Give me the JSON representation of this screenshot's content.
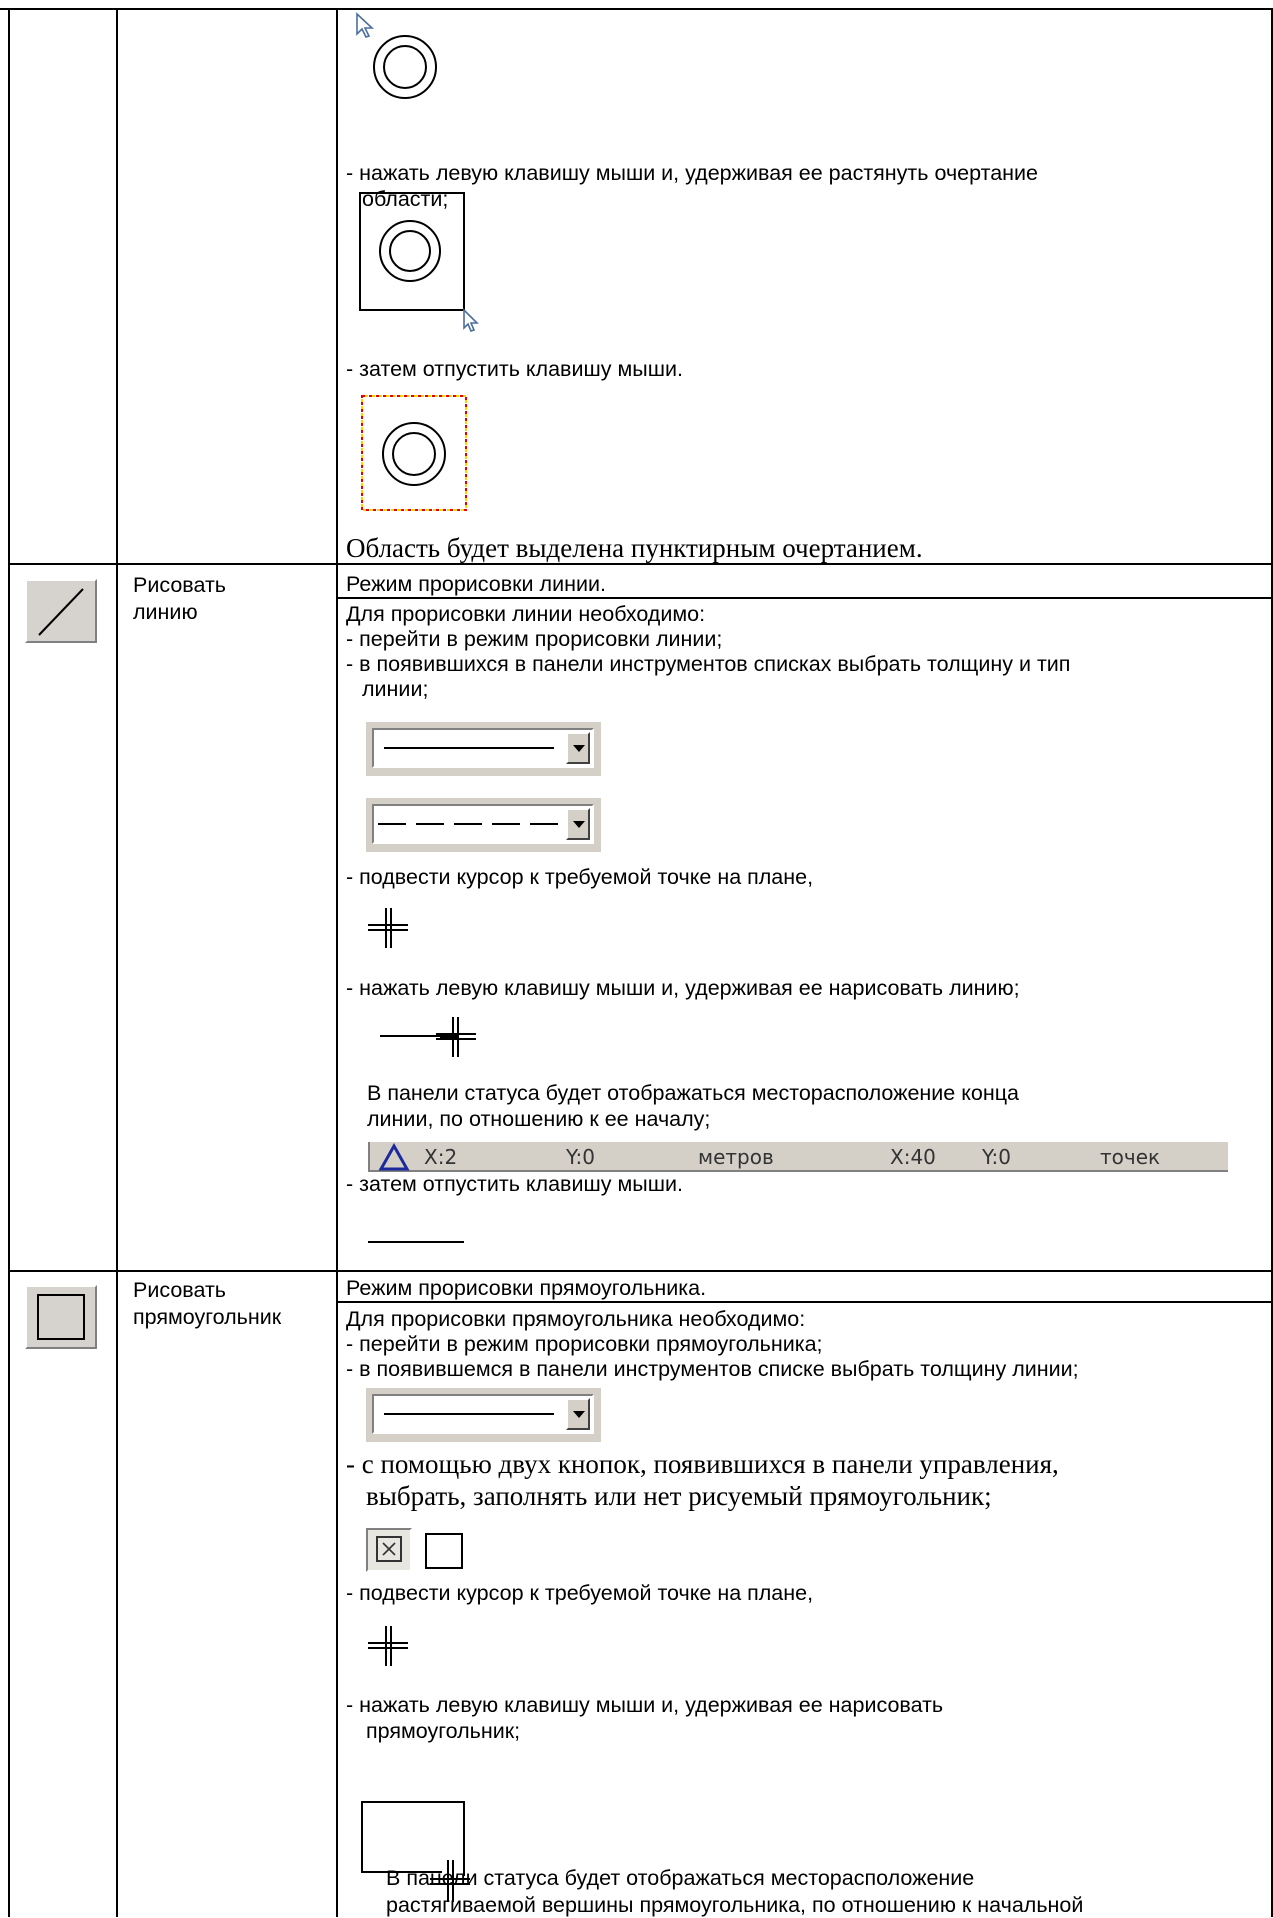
{
  "row1": {
    "line1": "- нажать левую клавишу мыши и, удерживая ее растянуть очертание",
    "line2": "области;",
    "line3": "-  затем отпустить клавишу мыши.",
    "note": "Область будет выделена пунктирным очертанием."
  },
  "row2": {
    "icon": "line-tool-icon",
    "name_line1": "Рисовать",
    "name_line2": "линию",
    "title": "Режим прорисовки линии.",
    "intro": "Для прорисовки линии необходимо:",
    "step1": "- перейти в режим прорисовки линии;",
    "step2a": "- в появившихся в панели инструментов списках выбрать толщину и тип",
    "step2b": "линии;",
    "step3": "- подвести курсор к требуемой точке на плане,",
    "step4": "- нажать левую клавишу мыши и, удерживая ее нарисовать линию;",
    "status_a": "В панели статуса будет отображаться месторасположение конца",
    "status_b": "линии, по отношению к ее началу;",
    "step5": "-  затем отпустить клавишу мыши.",
    "statusbar": {
      "x_m": "X:2",
      "y_m": "Y:0",
      "unit1": "метров",
      "x_px": "X:40",
      "y_px": "Y:0",
      "unit2": "точек"
    }
  },
  "row3": {
    "icon": "rectangle-tool-icon",
    "name_line1": "Рисовать",
    "name_line2": "прямоугольник",
    "title": "Режим прорисовки прямоугольника.",
    "intro": "Для прорисовки прямоугольника необходимо:",
    "step1": "- перейти в режим прорисовки прямоугольника;",
    "step2": "- в появившемся в панели инструментов списке выбрать толщину линии;",
    "step3a": "- с помощью двух кнопок, появившихся в панели управления,",
    "step3b": "выбрать, заполнять или нет рисуемый прямоугольник;",
    "step4": "- подвести курсор к требуемой точке на плане,",
    "step5a": "- нажать левую клавишу мыши и, удерживая ее нарисовать",
    "step5b": "прямоугольник;",
    "status_a": "В панели статуса будет отображаться месторасположение",
    "status_b": "растягиваемой вершины прямоугольника, по отношению к начальной"
  }
}
